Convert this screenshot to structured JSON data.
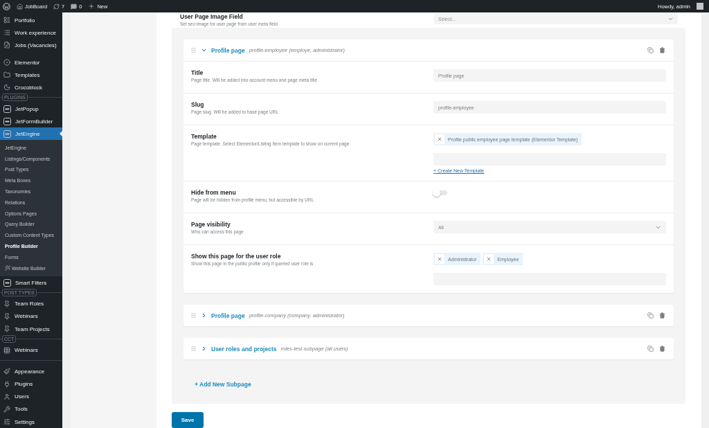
{
  "admin_bar": {
    "site": "JobBoard",
    "updates": "7",
    "comments": "0",
    "new": "New",
    "greeting": "Howdy, admin"
  },
  "sidebar": {
    "items": [
      {
        "kind": "item",
        "label": "Portfolio",
        "selected": false
      },
      {
        "kind": "item",
        "label": "Work experience",
        "selected": false
      },
      {
        "kind": "item",
        "label": "Jobs (Vacancies)",
        "selected": false
      },
      {
        "kind": "spacer"
      },
      {
        "kind": "item",
        "label": "Elementor",
        "selected": false
      },
      {
        "kind": "item",
        "label": "Templates",
        "selected": false
      },
      {
        "kind": "item",
        "label": "Crocoblock",
        "selected": false
      },
      {
        "kind": "separator",
        "label": "PLUGINS"
      },
      {
        "kind": "item",
        "label": "JetPopup",
        "selected": false
      },
      {
        "kind": "item",
        "label": "JetFormBuilder",
        "selected": false
      },
      {
        "kind": "item",
        "label": "JetEngine",
        "selected": true,
        "children": [
          {
            "label": "JetEngine",
            "selected": false
          },
          {
            "label": "Listings/Components",
            "selected": false
          },
          {
            "label": "Post Types",
            "selected": false
          },
          {
            "label": "Meta Boxes",
            "selected": false
          },
          {
            "label": "Taxonomies",
            "selected": false
          },
          {
            "label": "Relations",
            "selected": false
          },
          {
            "label": "Options Pages",
            "selected": false
          },
          {
            "label": "Query Builder",
            "selected": false
          },
          {
            "label": "Custom Content Types",
            "selected": false
          },
          {
            "label": "Profile Builder",
            "selected": true
          },
          {
            "label": "Forms",
            "selected": false
          },
          {
            "label": "Website Builder",
            "selected": false
          }
        ]
      },
      {
        "kind": "item",
        "label": "Smart Filters",
        "selected": false
      },
      {
        "kind": "separator",
        "label": "POST TYPES"
      },
      {
        "kind": "item",
        "label": "Team Roles",
        "selected": false
      },
      {
        "kind": "item",
        "label": "Webinars",
        "selected": false
      },
      {
        "kind": "item",
        "label": "Team Projects",
        "selected": false
      },
      {
        "kind": "separator",
        "label": "CCT"
      },
      {
        "kind": "item",
        "label": "Webinars",
        "selected": false
      },
      {
        "kind": "separator"
      },
      {
        "kind": "item",
        "label": "Appearance",
        "selected": false
      },
      {
        "kind": "item",
        "label": "Plugins",
        "selected": false
      },
      {
        "kind": "item",
        "label": "Users",
        "selected": false
      },
      {
        "kind": "item",
        "label": "Tools",
        "selected": false
      },
      {
        "kind": "item",
        "label": "Settings",
        "selected": false
      }
    ]
  },
  "top_field": {
    "label": "User Page Image Field",
    "description": "Set seo image for user page from user meta field",
    "placeholder": "Select..."
  },
  "subpages": [
    {
      "title": "Profile page",
      "meta": "profile-employee (employe, administrator)",
      "expanded": true,
      "fields": [
        {
          "kind": "text",
          "label": "Title",
          "description": "Page title. Will be added into account menu and page meta title",
          "value": "Profile page"
        },
        {
          "kind": "text",
          "label": "Slug",
          "description": "Page slug. Will be added to base page URL",
          "value": "profile-employee"
        },
        {
          "kind": "tags",
          "label": "Template",
          "description": "Page template. Select Elementor/Listing Item template to show on current page",
          "tags": [
            "Profile public employee page template (Elementor Template)"
          ],
          "link": "+ Create New Template"
        },
        {
          "kind": "switch",
          "label": "Hide from menu",
          "description": "Page will be hidden from profile menu, but accessible by URL",
          "on": false
        },
        {
          "kind": "select",
          "label": "Page visibility",
          "description": "Who can access this page",
          "value": "All"
        },
        {
          "kind": "tags",
          "label": "Show this page for the user role",
          "description": "Show this page in the public profile only if queried user role is",
          "tags": [
            "Administrator",
            "Employee"
          ]
        }
      ]
    },
    {
      "title": "Profile page",
      "meta": "profile-company (company, administrator)",
      "expanded": false
    },
    {
      "title": "User roles and projects",
      "meta": "roles-test-subpage (all users)",
      "expanded": false
    }
  ],
  "add_button": "+ Add New Subpage",
  "save_button": "Save"
}
